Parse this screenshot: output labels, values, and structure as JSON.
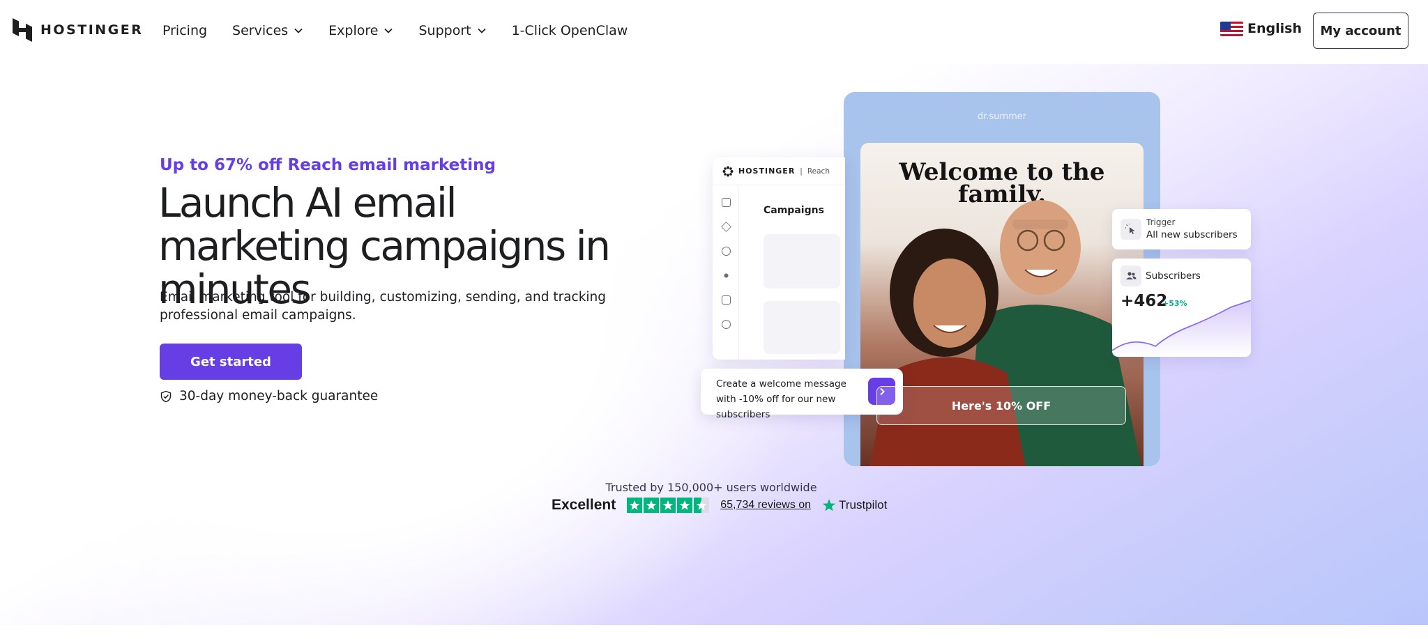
{
  "nav": {
    "brand": "HOSTINGER",
    "items": [
      {
        "label": "Pricing",
        "dropdown": false
      },
      {
        "label": "Services",
        "dropdown": true
      },
      {
        "label": "Explore",
        "dropdown": true
      },
      {
        "label": "Support",
        "dropdown": true
      },
      {
        "label": "1-Click OpenClaw",
        "dropdown": false
      }
    ],
    "language": "English",
    "account_label": "My account"
  },
  "hero": {
    "promo": "Up to 67% off Reach email marketing",
    "headline": "Launch AI email marketing campaigns in minutes",
    "description": "Email marketing tool for building, customizing, sending, and tracking professional email campaigns.",
    "cta_label": "Get started",
    "guarantee": "30-day money-back guarantee"
  },
  "illustration": {
    "handle": "dr.summer",
    "email_title": "Welcome to the family.",
    "offer_label": "Here's 10% OFF",
    "app_brand": "HOSTINGER",
    "app_product": "Reach",
    "app_section": "Campaigns",
    "prompt": "Create a welcome message with -10% off for our new subscribers",
    "trigger_label": "Trigger",
    "trigger_value": "All new subscribers",
    "subscribers_label": "Subscribers",
    "subscribers_value": "+462",
    "subscribers_change": "+53%"
  },
  "trust": {
    "trusted_text": "Trusted by 150,000+ users worldwide",
    "rating_label": "Excellent",
    "stars": 4.5,
    "reviews_text": "65,734 reviews on",
    "platform": "Trustpilot"
  },
  "colors": {
    "accent": "#673de6",
    "text": "#1d1e20",
    "trustpilot_green": "#00b67a"
  }
}
